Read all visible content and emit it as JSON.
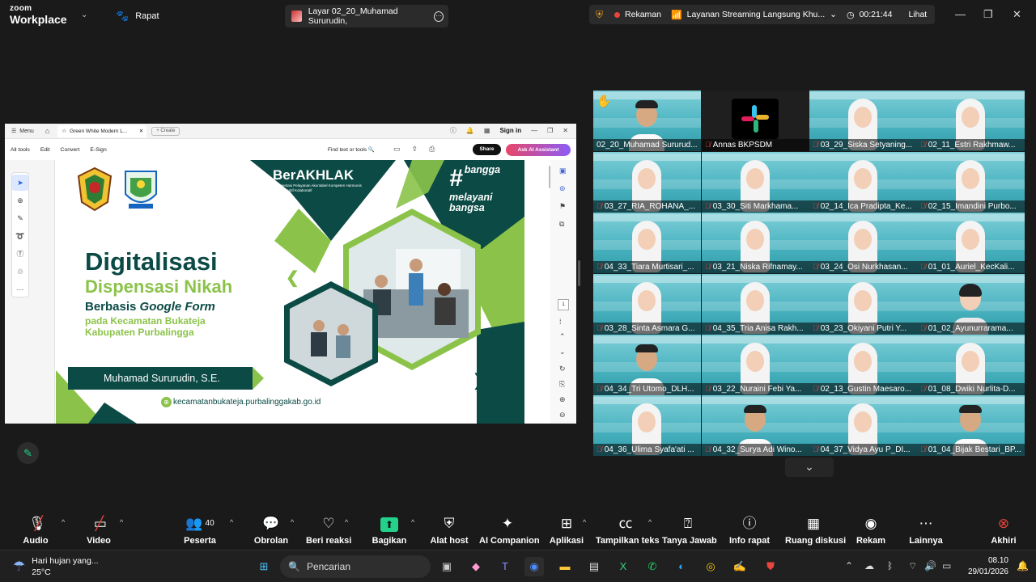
{
  "topbar": {
    "logo_line1": "zoom",
    "logo_line2": "Workplace",
    "meeting_label": "Rapat",
    "share_title": "Layar 02_20_Muhamad Sururudin,",
    "recording": "Rekaman",
    "streaming": "Layanan Streaming Langsung Khu...",
    "elapsed": "00:21:44",
    "view_label": "Lihat"
  },
  "browser": {
    "menu": "Menu",
    "tab_title": "Green White Modern L...",
    "create": "Create",
    "sign_in": "Sign in",
    "toolbar": [
      "All tools",
      "Edit",
      "Convert",
      "E-Sign"
    ],
    "find": "Find text or tools",
    "share": "Share",
    "ai": "Ask AI Assistant",
    "page_number": "1"
  },
  "slide": {
    "title": "Digitalisasi",
    "subtitle": "Dispensasi Nikah",
    "line3_a": "Berbasis",
    "line3_b": "Google Form",
    "line4": "pada Kecamatan Bukateja",
    "line5": "Kabupaten Purbalingga",
    "presenter": "Muhamad Sururudin, S.E.",
    "url": "kecamatanbukateja.purbalinggakab.go.id",
    "berakhlak": "BerAKHLAK",
    "berakhlak_sub": "Berorientasi Pelayanan Akuntabel Kompeten Harmonis Loyal Adaptif Kolaboratif",
    "bangga1": "bangga",
    "bangga2": "melayani",
    "bangga3": "bangsa"
  },
  "gallery": [
    {
      "name": "02_20_Muhamad Sururud...",
      "muted": false,
      "speaking": true,
      "hand": true,
      "kind": "man"
    },
    {
      "name": "Annas BKPSDM",
      "muted": true,
      "kind": "novideo"
    },
    {
      "name": "03_29_Siska Setyaning...",
      "muted": true,
      "kind": "hijab"
    },
    {
      "name": "02_11_Estri Rakhmaw...",
      "muted": true,
      "kind": "hijab"
    },
    {
      "name": "03_27_RIA_ROHANA_...",
      "muted": true,
      "kind": "hijab"
    },
    {
      "name": "03_30_Siti Markhama...",
      "muted": true,
      "kind": "hijab"
    },
    {
      "name": "02_14_Ica Pradipta_Ke...",
      "muted": true,
      "kind": "hijab"
    },
    {
      "name": "02_15_Imandini Purbo...",
      "muted": true,
      "kind": "hijab"
    },
    {
      "name": "04_33_Tiara Murtisari_...",
      "muted": true,
      "kind": "hijab"
    },
    {
      "name": "03_21_Niska Rifnamay...",
      "muted": true,
      "kind": "hijab"
    },
    {
      "name": "03_24_Osi Nurkhasan...",
      "muted": true,
      "kind": "hijab"
    },
    {
      "name": "01_01_Auriel_KecKali...",
      "muted": true,
      "kind": "hijab"
    },
    {
      "name": "03_28_Sinta Asmara G...",
      "muted": true,
      "kind": "hijab"
    },
    {
      "name": "04_35_Tria Anisa Rakh...",
      "muted": true,
      "kind": "hijab"
    },
    {
      "name": "03_23_Okiyani Putri Y...",
      "muted": true,
      "kind": "hijab"
    },
    {
      "name": "01_02_Ayunurrarama...",
      "muted": true,
      "kind": "hair"
    },
    {
      "name": "04_34_Tri Utomo_DLH...",
      "muted": true,
      "kind": "man"
    },
    {
      "name": "03_22_Nuraini Febi Ya...",
      "muted": true,
      "kind": "hijab"
    },
    {
      "name": "02_13_Gustin Maesaro...",
      "muted": true,
      "kind": "hijab"
    },
    {
      "name": "01_08_Dwiki Nurlita-D...",
      "muted": true,
      "kind": "hijab"
    },
    {
      "name": "04_36_Ulima Syafa'ati ...",
      "muted": true,
      "kind": "hijab"
    },
    {
      "name": "04_32_Surya Adi Wino...",
      "muted": true,
      "kind": "man"
    },
    {
      "name": "04_37_Vidya Ayu P_DI...",
      "muted": true,
      "kind": "hijab"
    },
    {
      "name": "01_04_Bijak Bestari_BP...",
      "muted": true,
      "kind": "man"
    }
  ],
  "toolbar": {
    "audio": "Audio",
    "video": "Video",
    "participants": "Peserta",
    "participants_count": "40",
    "chat": "Obrolan",
    "reactions": "Beri reaksi",
    "share": "Bagikan",
    "host_tools": "Alat host",
    "ai_companion": "AI Companion",
    "apps": "Aplikasi",
    "captions": "Tampilkan teks",
    "qa": "Tanya Jawab",
    "info": "Info rapat",
    "breakout": "Ruang diskusi",
    "record": "Rekam",
    "more": "Lainnya",
    "end": "Akhiri"
  },
  "taskbar": {
    "weather_text": "Hari hujan yang...",
    "temperature": "25°C",
    "search": "Pencarian",
    "time": "08.10",
    "date": "29/01/2026"
  },
  "colors": {
    "accent_green": "#23d18b",
    "record_red": "#e8453c",
    "slide_dark": "#0b4a45",
    "slide_lime": "#8bc34a"
  }
}
